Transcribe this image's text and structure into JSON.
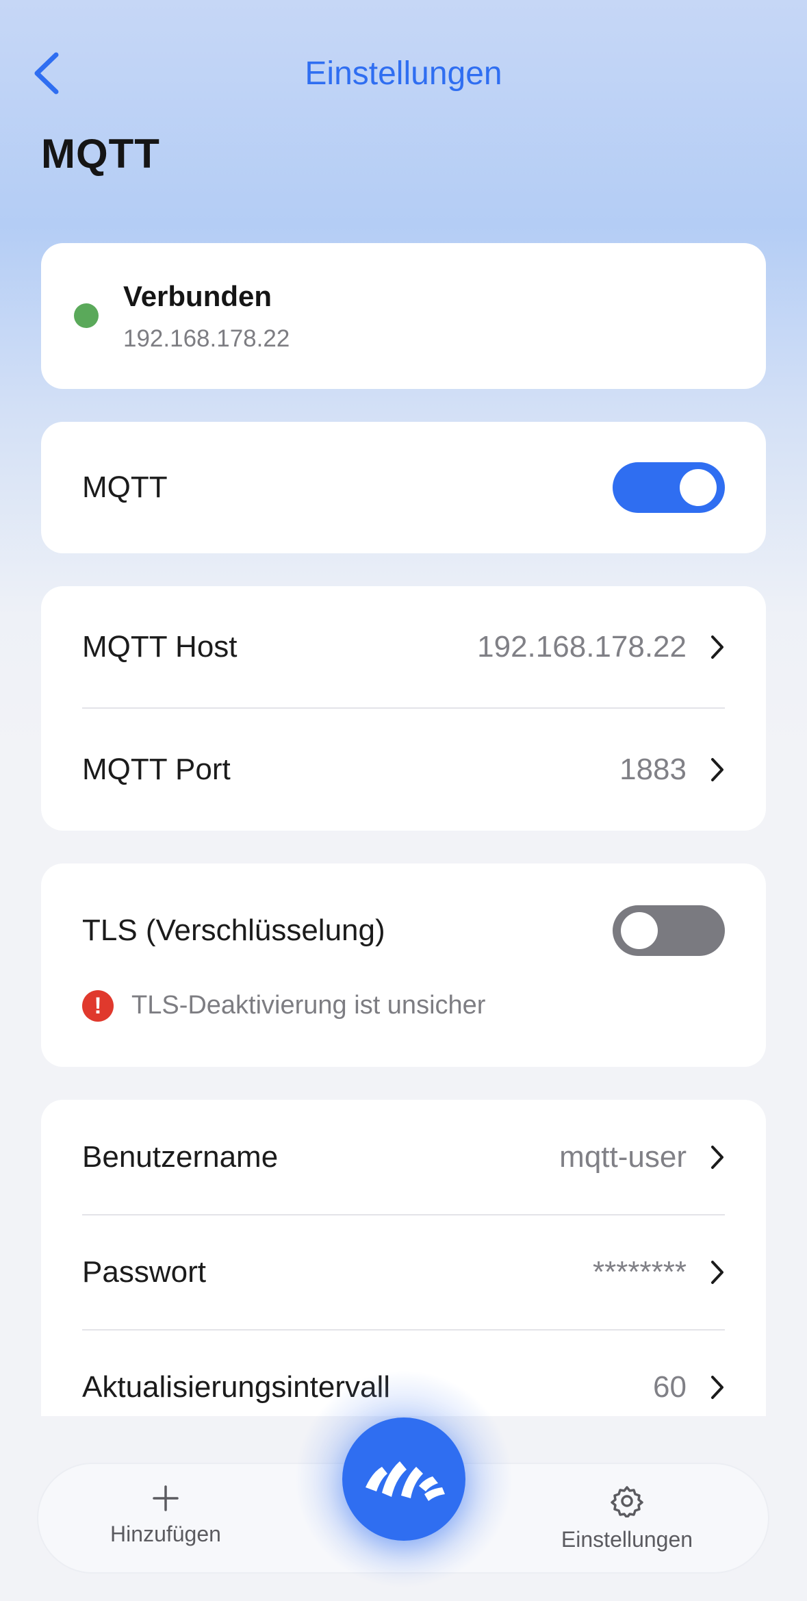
{
  "header": {
    "back_icon": "chevron-left-icon",
    "title": "Einstellungen",
    "page_title": "MQTT"
  },
  "status": {
    "title": "Verbunden",
    "address": "192.168.178.22",
    "dot_color": "#5aa95a"
  },
  "mqtt_toggle": {
    "label": "MQTT",
    "on": true
  },
  "connection": {
    "host_label": "MQTT Host",
    "host_value": "192.168.178.22",
    "port_label": "MQTT Port",
    "port_value": "1883"
  },
  "tls": {
    "label": "TLS (Verschlüsselung)",
    "on": false,
    "warning_icon": "!",
    "warning_text": "TLS-Deaktivierung ist unsicher",
    "warning_color": "#e0392d"
  },
  "credentials": {
    "username_label": "Benutzername",
    "username_value": "mqtt-user",
    "password_label": "Passwort",
    "password_value": "********",
    "interval_label": "Aktualisierungsintervall",
    "interval_value": "60"
  },
  "bottom_nav": {
    "add_label": "Hinzufügen",
    "settings_label": "Einstellungen",
    "center_icon": "home-logo-icon"
  },
  "colors": {
    "accent": "#2f6ef1",
    "toggle_off": "#7a7a80"
  }
}
